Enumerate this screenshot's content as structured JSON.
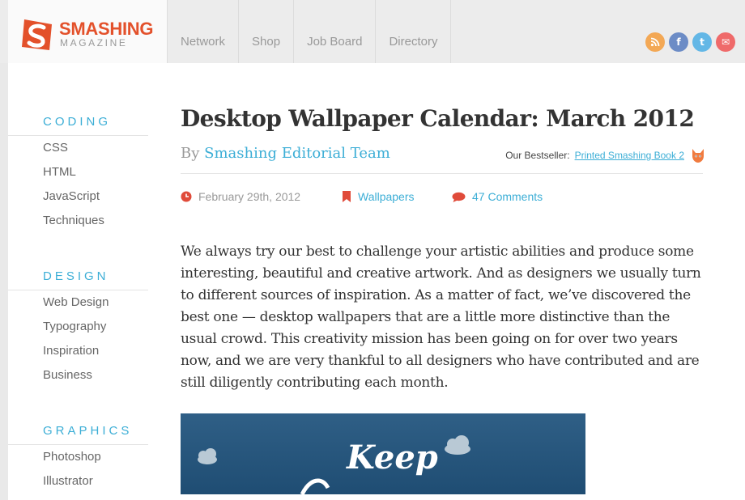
{
  "logo": {
    "top": "SMASHING",
    "bottom": "MAGAZINE"
  },
  "nav": [
    "Network",
    "Shop",
    "Job Board",
    "Directory"
  ],
  "social": [
    {
      "icon": "rss-icon",
      "glyph": "ʃ",
      "color": "#f3a855"
    },
    {
      "icon": "facebook-icon",
      "glyph": "f",
      "color": "#6c8cc6"
    },
    {
      "icon": "twitter-icon",
      "glyph": "t",
      "color": "#63b7e6"
    },
    {
      "icon": "mail-icon",
      "glyph": "✉",
      "color": "#ef6a6a"
    }
  ],
  "sidebar": [
    {
      "heading": "CODING",
      "links": [
        "CSS",
        "HTML",
        "JavaScript",
        "Techniques"
      ]
    },
    {
      "heading": "DESIGN",
      "links": [
        "Web Design",
        "Typography",
        "Inspiration",
        "Business"
      ]
    },
    {
      "heading": "GRAPHICS",
      "links": [
        "Photoshop",
        "Illustrator"
      ]
    }
  ],
  "article": {
    "title": "Desktop Wallpaper Calendar: March 2012",
    "by": "By",
    "author": "Smashing Editorial Team",
    "bestseller_label": "Our Bestseller:",
    "bestseller_link": "Printed Smashing Book 2",
    "date": "February 29th, 2012",
    "category": "Wallpapers",
    "comments": "47 Comments",
    "body": "We always try our best to challenge your artistic abilities and produce some interesting, beautiful and creative artwork. And as designers we usually turn to different sources of inspiration. As a matter of fact, we’ve discovered the best one — desktop wallpapers that are a little more distinctive than the usual crowd. This creativity mission has been going on for over two years now, and we are very thankful to all designers who have contributed and are still diligently contributing each month.",
    "image_text": "Keep"
  },
  "colors": {
    "accent": "#3caed6",
    "brand": "#e3512b",
    "meta_icon": "#e04b3a"
  }
}
